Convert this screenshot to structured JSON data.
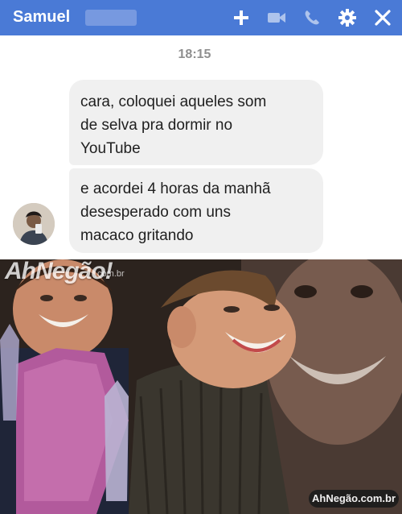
{
  "header": {
    "contact_name": "Samuel",
    "accent_color": "#4a7ad6",
    "icons": [
      "plus-icon",
      "video-camera-icon",
      "phone-icon",
      "gear-icon",
      "close-icon"
    ]
  },
  "conversation": {
    "timestamp": "18:15",
    "messages": [
      {
        "lines": [
          "cara, coloquei aqueles som",
          "de selva pra dormir no",
          "YouTube"
        ]
      },
      {
        "lines": [
          "e acordei 4 horas da manhã",
          "desesperado com uns",
          "macaco gritando"
        ]
      }
    ]
  },
  "meme": {
    "watermark": "AhNegão!",
    "watermark_domain": ".com.br",
    "badge": "AhNegão.com.br"
  }
}
